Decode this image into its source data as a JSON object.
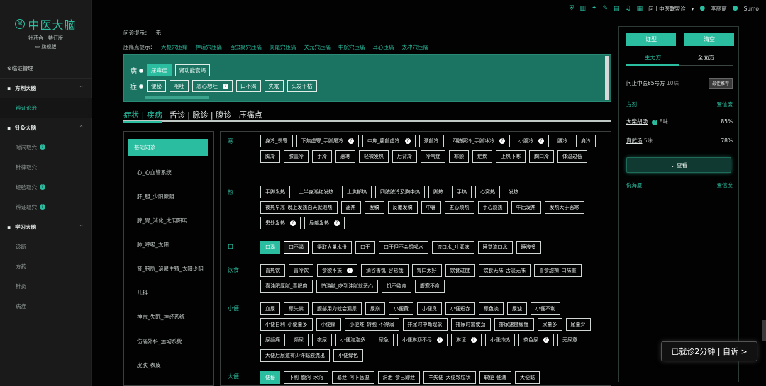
{
  "brand": {
    "title": "中医大脑",
    "subtitle": "针药合一特订版",
    "version": "旗舰版"
  },
  "topbar": {
    "org": "问止中医联盟诊",
    "user": "李丽丽",
    "account": "Sumo"
  },
  "sidebar": [
    {
      "label": "临证管理",
      "type": "top"
    },
    {
      "label": "方剂大脑",
      "type": "sect"
    },
    {
      "label": "辨证论治",
      "type": "sub",
      "active": true
    },
    {
      "label": "针灸大脑",
      "type": "sect"
    },
    {
      "label": "时间取穴",
      "type": "sub",
      "badge": true
    },
    {
      "label": "针律取穴",
      "type": "sub"
    },
    {
      "label": "经验取穴",
      "type": "sub",
      "badge": true
    },
    {
      "label": "辨证取穴",
      "type": "sub",
      "badge": true
    },
    {
      "label": "学习大脑",
      "type": "sect"
    },
    {
      "label": "诊断",
      "type": "sub"
    },
    {
      "label": "方药",
      "type": "sub"
    },
    {
      "label": "针灸",
      "type": "sub"
    },
    {
      "label": "病症",
      "type": "sub"
    }
  ],
  "hints": {
    "question_label": "问诊提示：",
    "question_value": "无",
    "pressure_label": "压痛点提示：",
    "pressure_points": [
      "天枢穴压痛",
      "神道穴压痛",
      "百虫窝穴压痛",
      "阑尾穴压痛",
      "关元穴压痛",
      "中脘穴压痛",
      "耳心压痛",
      "太冲穴压痛"
    ]
  },
  "input": {
    "disease_label": "病",
    "disease_tags": [
      "尿毒症",
      "肾功能衰竭"
    ],
    "symptom_label": "症",
    "symptom_tags": [
      "便秘",
      "呕吐",
      "恶心想吐",
      "口不渴",
      "失眠",
      "头发干枯"
    ]
  },
  "tabs": {
    "active": "症状 | 疾病",
    "rest": "舌诊 | 脉诊 | 腹诊 | 压痛点"
  },
  "categories": [
    "基础问诊",
    "心_心血管系统",
    "肝_胆_少阳厥阴",
    "脾_胃_消化_太阴阳明",
    "肺_呼吸_太阳",
    "肾_膀胱_泌尿生殖_太阳少阴",
    "儿科",
    "神志_失眠_神经系统",
    "伤痛外科_运动系统",
    "皮肤_表皮"
  ],
  "symptoms": [
    {
      "group": "寒",
      "tags": [
        "身冷_畏寒",
        "下焦虚寒_手脚尾冷",
        "中焦_腹部虚冷",
        "颈部冷",
        "四肢厥冷_手脚冰冷",
        "小腹冷",
        "腰冷",
        "肩冷",
        "脚冷",
        "膝盖冷",
        "手冷",
        "恶寒",
        "轻微发热",
        "后背冷",
        "冷气症",
        "寒颤",
        "疟疾",
        "上热下寒",
        "胸口冷",
        "体温过低"
      ],
      "badges": [
        1,
        2,
        4,
        5
      ]
    },
    {
      "group": "热",
      "tags": [
        "手脚发热",
        "上半身潮红发热",
        "上焦郁热",
        "四肢肢冷及胸中热",
        "脚热",
        "手热",
        "心窝热",
        "发热",
        "夜热早凉_晚上发热白天就退热",
        "恶热",
        "发稿",
        "反覆发稿",
        "中暑",
        "五心烦热",
        "手心烦热",
        "午后发热",
        "发热大于恶寒",
        "患处发热",
        "局部发热"
      ],
      "badges": [
        17,
        18
      ]
    },
    {
      "group": "口",
      "tags": [
        "口渴",
        "口不渴",
        "摄取大量水份",
        "口干",
        "口干但不会想喝水",
        "流口水_吐涎沫",
        "睡觉流口水",
        "睡液多"
      ],
      "filled": [
        0
      ],
      "outline": [
        1
      ]
    },
    {
      "group": "饮食",
      "tags": [
        "喜热饮",
        "喜冷饮",
        "食欲不振",
        "消谷善饥_容易饿",
        "胃口太好",
        "饮食过度",
        "饮食无味_舌淡无味",
        "喜食甜辣_口味重",
        "喜油肥厚腻_喜肥肉",
        "怕油腻_吃到油腻就恶心",
        "饥不欲食",
        "腹寒不食"
      ],
      "badges": [
        2
      ]
    },
    {
      "group": "小便",
      "tags": [
        "血尿",
        "尿失禁",
        "腹部用力就会漏尿",
        "尿崩",
        "小便黄",
        "小便臭",
        "小便短赤",
        "尿色淡",
        "尿浊",
        "小便不利",
        "小便自利_小便量多",
        "小便痛",
        "小便难_转胞_不得溺",
        "排尿时中断现象",
        "排尿时需使劲",
        "排尿速度缓慢",
        "尿量多",
        "尿量少",
        "尿频痛",
        "频尿",
        "夜尿",
        "小便泡泡多",
        "尿急",
        "小便淋沥不尽",
        "淋证",
        "小便灼热",
        "茶色尿",
        "无尿意",
        "大便后尿道有少许黏液流出",
        "小便绿色"
      ],
      "badges": [
        23,
        24,
        26
      ]
    },
    {
      "group": "大便",
      "tags": [
        "便秘",
        "下利_腹泻_水泻",
        "暴泄_泻下急迫",
        "洞泄_食已即泄",
        "羊矢便_大便颗粒状",
        "软便_便溏",
        "大便黏"
      ],
      "filled": [
        0
      ]
    }
  ],
  "right": {
    "btn1": "证型",
    "btn2": "清空",
    "tab1": "主力方",
    "tab2": "全面方",
    "formula": "问止中医85号方",
    "formula_count": "10味",
    "best": "最佳推荐",
    "col1": "方剂",
    "col2": "置信度",
    "rows": [
      {
        "name": "大柴胡汤",
        "count": "8味",
        "conf": "85%"
      },
      {
        "name": "真武汤",
        "count": "5味",
        "conf": "78%"
      }
    ],
    "view": "查看",
    "footer_name": "倪海厦",
    "footer_conf": "置信度"
  },
  "toast": "已就诊2分钟 | 自诉 >"
}
